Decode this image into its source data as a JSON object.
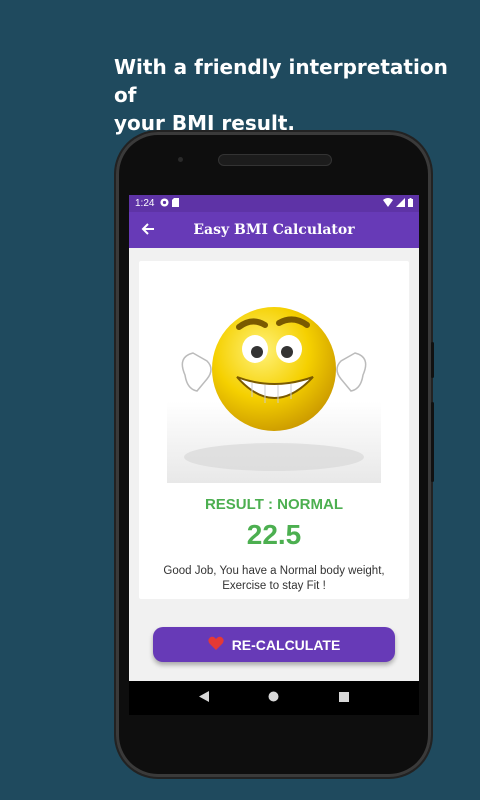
{
  "promo": {
    "line1": "With a friendly interpretation of",
    "line2": "your BMI result."
  },
  "status_bar": {
    "time": "1:24",
    "icons": [
      "settings-icon",
      "sim-icon",
      "wifi-icon",
      "signal-icon",
      "battery-icon"
    ]
  },
  "app_bar": {
    "title": "Easy BMI Calculator",
    "back_icon": "arrow-back-icon"
  },
  "result": {
    "label": "RESULT : NORMAL",
    "value": "22.5",
    "message_line1": "Good Job, You have a Normal body weight,",
    "message_line2": "Exercise to stay Fit !",
    "color": "#4caf50"
  },
  "recalculate": {
    "label": "RE-CALCULATE",
    "icon": "heart-icon",
    "icon_color": "#e53935"
  },
  "nav": {
    "icons": [
      "back-triangle-icon",
      "home-circle-icon",
      "recents-square-icon"
    ]
  },
  "colors": {
    "background": "#1f4a5e",
    "primary": "#673ab7",
    "status_bar": "#5e33a6"
  }
}
